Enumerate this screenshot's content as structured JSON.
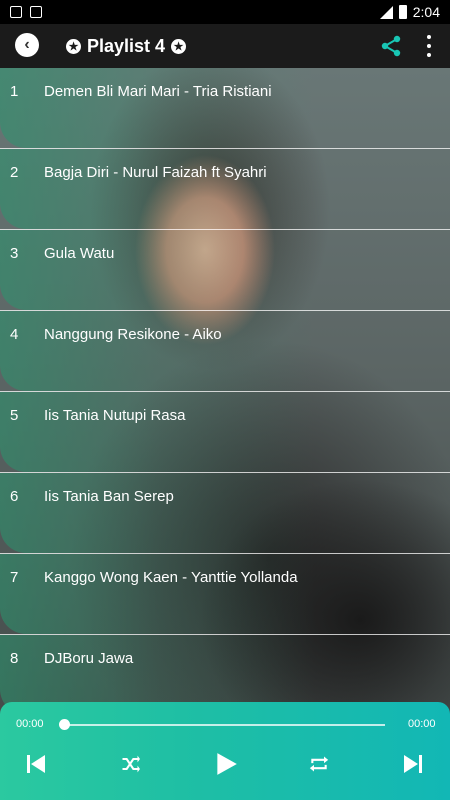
{
  "status": {
    "time": "2:04"
  },
  "app": {
    "title": "Playlist 4"
  },
  "songs": [
    {
      "num": "1",
      "title": "Demen Bli Mari Mari - Tria Ristiani"
    },
    {
      "num": "2",
      "title": "Bagja Diri - Nurul Faizah ft Syahri"
    },
    {
      "num": "3",
      "title": "Gula Watu"
    },
    {
      "num": "4",
      "title": "Nanggung Resikone - Aiko"
    },
    {
      "num": "5",
      "title": "Iis Tania Nutupi Rasa"
    },
    {
      "num": "6",
      "title": "Iis Tania Ban Serep"
    },
    {
      "num": "7",
      "title": "Kanggo Wong Kaen - Yanttie Yollanda"
    },
    {
      "num": "8",
      "title": "DJBoru Jawa"
    }
  ],
  "player": {
    "elapsed": "00:00",
    "duration": "00:00",
    "progress": 0
  },
  "icons": {
    "back": "chevron-left-icon",
    "star": "star-badge-icon",
    "share": "share-icon",
    "more": "more-vert-icon",
    "prev": "skip-previous-icon",
    "shuffle": "shuffle-icon",
    "play": "play-icon",
    "repeat": "repeat-icon",
    "next": "skip-next-icon"
  },
  "colors": {
    "accent": "#1fc3a6",
    "appbar": "#1b1b1b",
    "share": "#19c6b4"
  }
}
